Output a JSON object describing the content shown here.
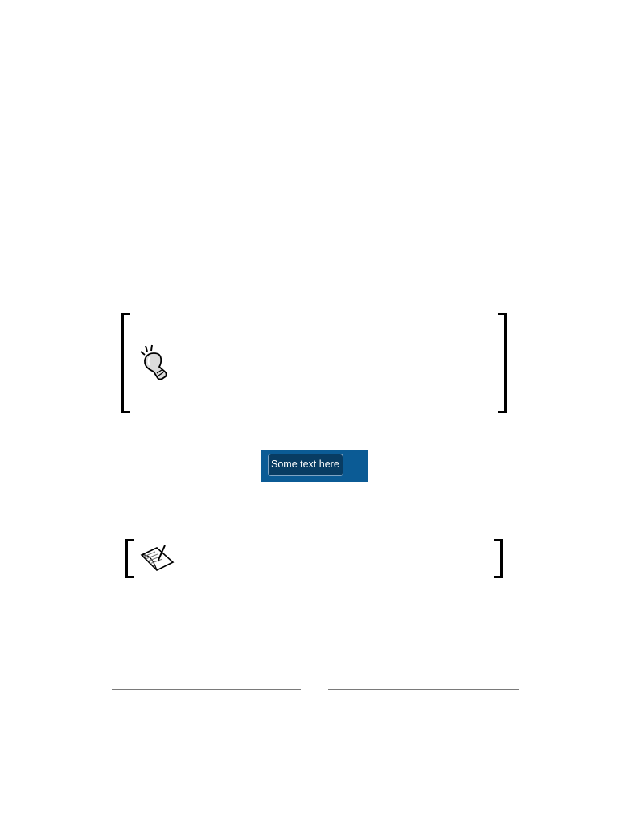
{
  "header": {},
  "tip_box": {
    "icon": "lightbulb-icon"
  },
  "figure": {
    "textbox_text": "Some text here"
  },
  "note_box": {
    "icon": "note-paper-icon"
  },
  "footer": {}
}
